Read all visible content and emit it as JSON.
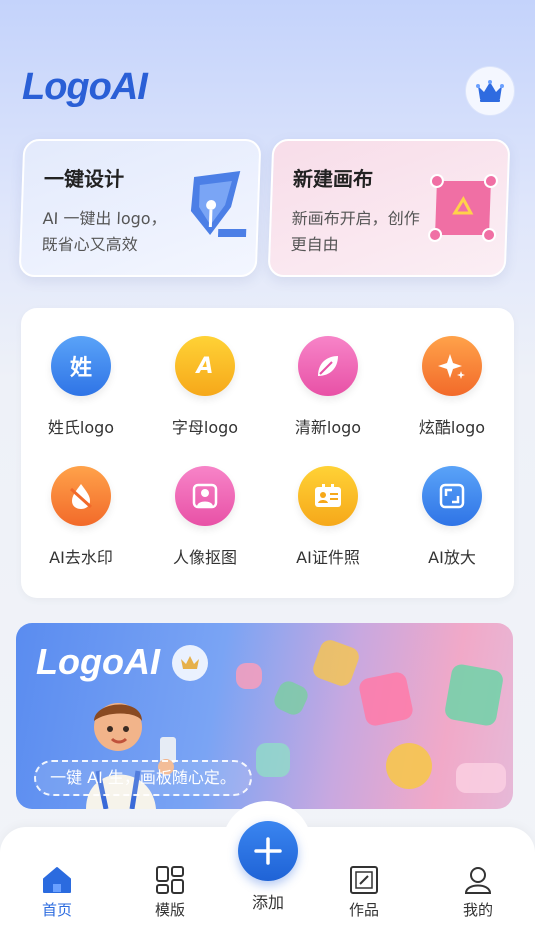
{
  "header": {
    "logo_text": "LogoAI",
    "vip_icon": "crown-icon"
  },
  "cards": {
    "design": {
      "title": "一键设计",
      "desc": "AI 一键出 logo，既省心又高效",
      "icon": "pen-nib-icon"
    },
    "canvas": {
      "title": "新建画布",
      "desc": "新画布开启，创作更自由",
      "icon": "canvas-icon"
    }
  },
  "tools": [
    {
      "label": "姓氏logo",
      "glyph": "姓",
      "icon": "surname-icon"
    },
    {
      "label": "字母logo",
      "glyph": "A",
      "icon": "letter-icon"
    },
    {
      "label": "清新logo",
      "glyph": "",
      "icon": "leaf-icon"
    },
    {
      "label": "炫酷logo",
      "glyph": "",
      "icon": "sparkle-icon"
    },
    {
      "label": "AI去水印",
      "glyph": "",
      "icon": "drop-icon"
    },
    {
      "label": "人像抠图",
      "glyph": "",
      "icon": "person-icon"
    },
    {
      "label": "AI证件照",
      "glyph": "",
      "icon": "id-card-icon"
    },
    {
      "label": "AI放大",
      "glyph": "",
      "icon": "enlarge-icon"
    }
  ],
  "banner": {
    "logo_text": "LogoAI",
    "slogan": "一键 AI 生，画板随心定。"
  },
  "tabbar": {
    "home": "首页",
    "templates": "模版",
    "add": "添加",
    "works": "作品",
    "mine": "我的"
  },
  "colors": {
    "accent": "#2b6bdf",
    "brand": "#2a5fd6"
  }
}
